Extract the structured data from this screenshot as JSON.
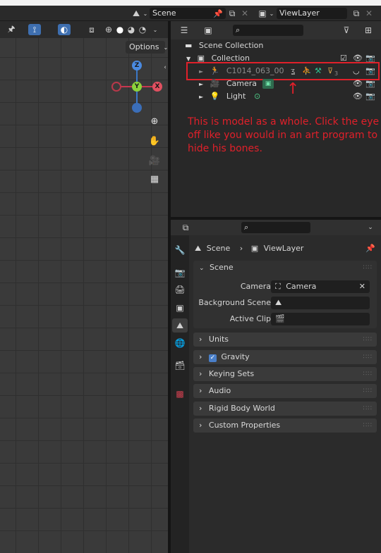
{
  "topbar": {
    "scene_label": "Scene",
    "viewlayer_label": "ViewLayer"
  },
  "viewport": {
    "options_label": "Options",
    "gizmo": {
      "z": "Z",
      "y": "Y",
      "x": "X"
    }
  },
  "outliner": {
    "scene_collection": "Scene Collection",
    "collection": "Collection",
    "items": [
      {
        "label": "C1014_063_00",
        "icon": "armature-icon",
        "badge": "3"
      },
      {
        "label": "Camera",
        "icon": "camera-object-icon"
      },
      {
        "label": "Light",
        "icon": "light-object-icon"
      }
    ]
  },
  "annotation": {
    "line1": "This is model as a whole. Click the eye",
    "line2": "off like you would in an art program to",
    "line3": "hide his bones.",
    "color": "#e0202a"
  },
  "properties": {
    "breadcrumb_scene": "Scene",
    "breadcrumb_viewlayer": "ViewLayer",
    "scene_panel": "Scene",
    "camera_label": "Camera",
    "camera_value": "Camera",
    "background_scene_label": "Background Scene",
    "active_clip_label": "Active Clip",
    "panels": [
      "Units",
      "Gravity",
      "Keying Sets",
      "Audio",
      "Rigid Body World",
      "Custom Properties"
    ]
  }
}
